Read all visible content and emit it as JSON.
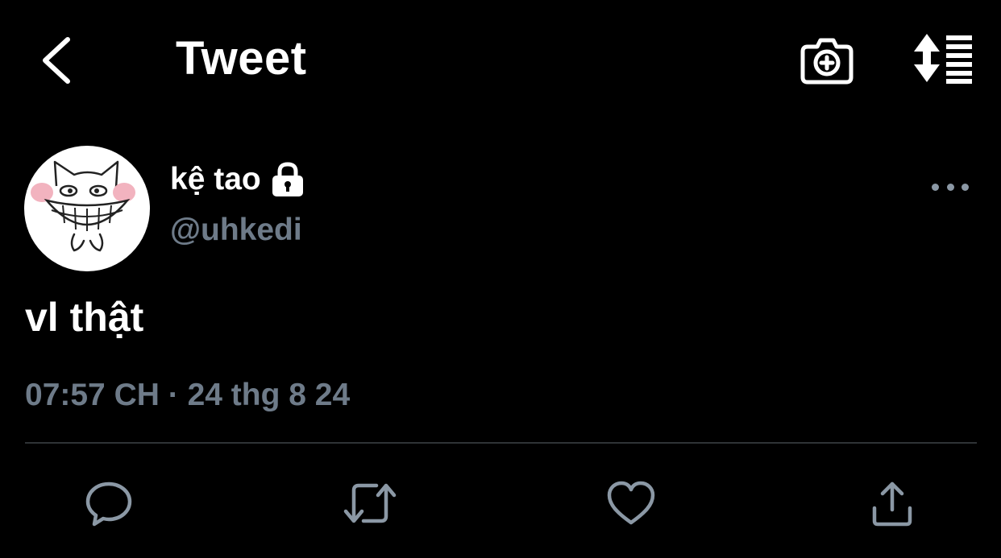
{
  "header": {
    "title": "Tweet",
    "back_icon": "chevron-left-icon",
    "camera_icon": "camera-add-icon",
    "sort_icon": "sort-list-icon"
  },
  "tweet": {
    "author": {
      "display_name": "kệ tao",
      "handle": "@uhkedi",
      "protected": true
    },
    "text": "vl thật",
    "timestamp": "07:57 CH · 24 thg 8 24"
  },
  "actions": [
    {
      "name": "reply",
      "icon": "reply-icon"
    },
    {
      "name": "retweet",
      "icon": "retweet-icon"
    },
    {
      "name": "like",
      "icon": "heart-icon"
    },
    {
      "name": "share",
      "icon": "share-icon"
    }
  ],
  "colors": {
    "background": "#000000",
    "primary_text": "#ffffff",
    "secondary_text": "#6e7b89",
    "icon": "#8b98a5",
    "divider": "#2f3336"
  }
}
